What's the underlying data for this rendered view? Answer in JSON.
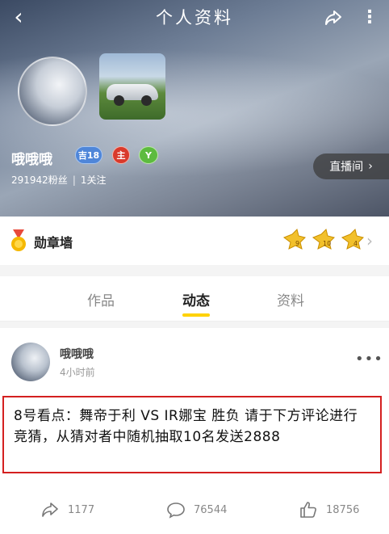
{
  "header": {
    "title": "个人资料",
    "nickname": "哦哦哦",
    "level_badge": "吉18",
    "host_badge": "主",
    "verify_badge": "Y",
    "followers": "291942粉丝",
    "following": "1关注",
    "live_button": "直播间"
  },
  "medals": {
    "label": "勋章墙",
    "badges": [
      "9",
      "10",
      "4"
    ]
  },
  "tabs": [
    {
      "label": "作品"
    },
    {
      "label": "动态"
    },
    {
      "label": "资料"
    }
  ],
  "post": {
    "author": "哦哦哦",
    "time": "4小时前",
    "text": "8号看点：舞帝于利 VS IR娜宝 胜负 请于下方评论进行竞猜，从猜对者中随机抽取10名发送2888",
    "share_count": "1177",
    "comment_count": "76544",
    "like_count": "18756"
  }
}
